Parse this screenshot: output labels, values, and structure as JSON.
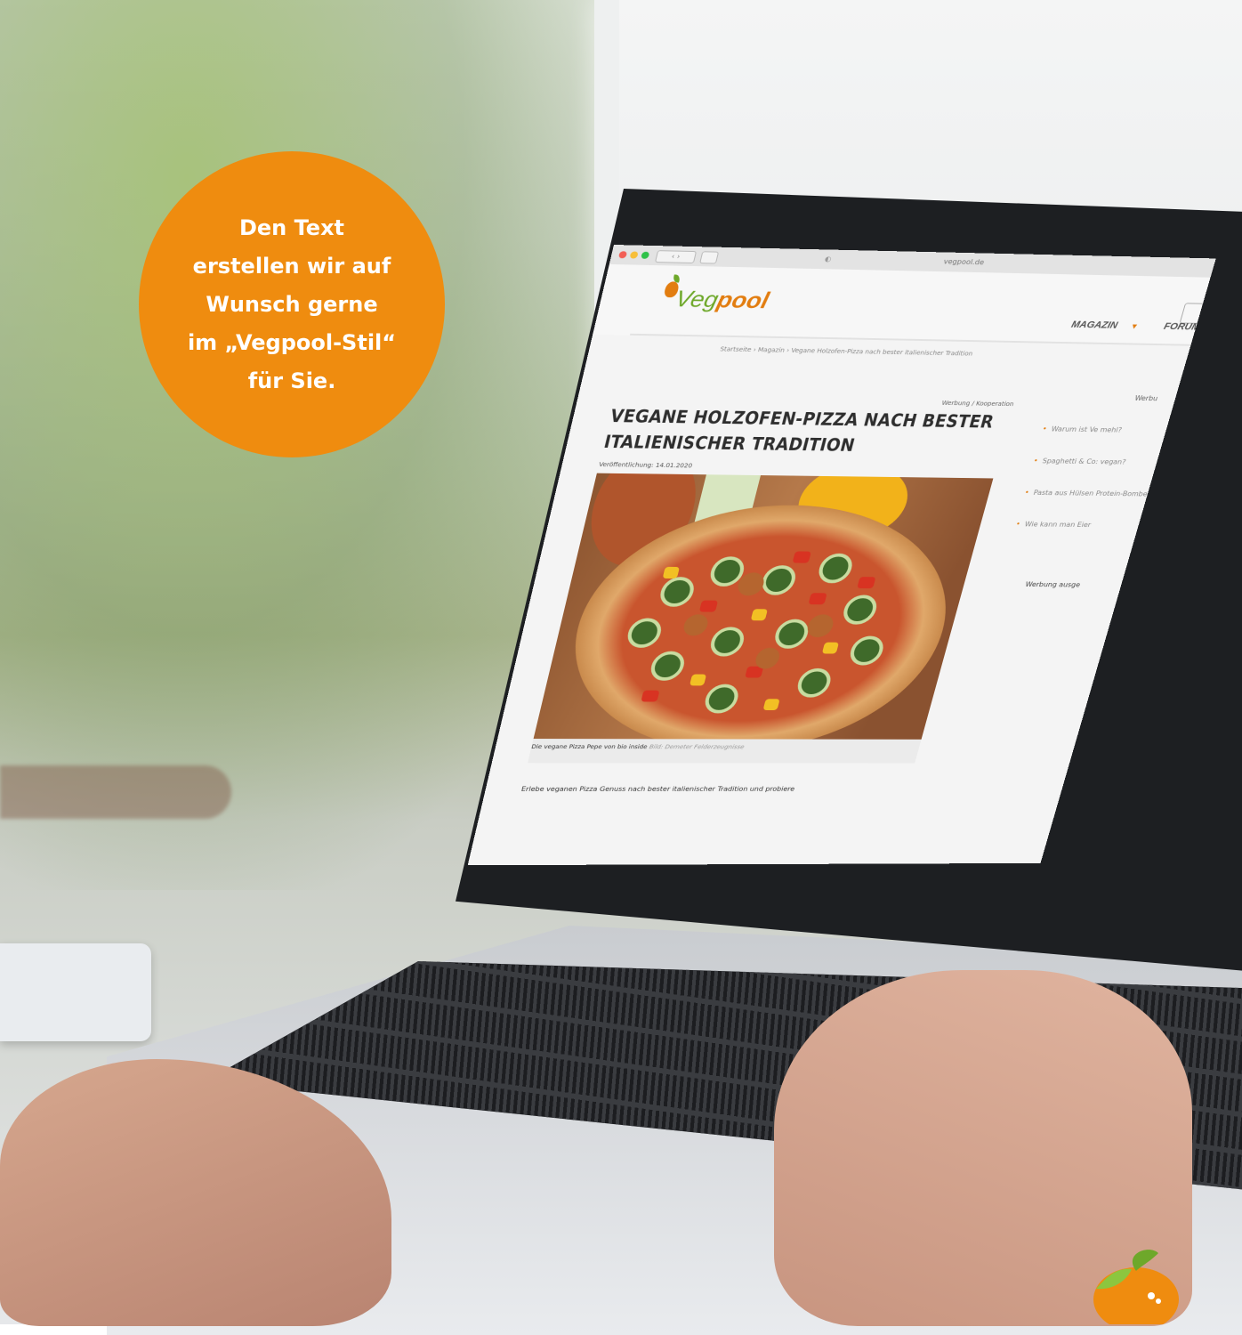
{
  "badge": {
    "text": "Den Text\nerstellen wir auf\nWunsch gerne\nim „Vegpool-Stil“\nfür Sie.",
    "color": "#ef8c0f"
  },
  "browser": {
    "url": "vegpool.de",
    "privacy_icon": "privacy-report-icon",
    "nav_glyphs": "‹ ›"
  },
  "site": {
    "logo_veg": "Veg",
    "logo_pool": "pool",
    "menu": {
      "magazin": "MAGAZIN",
      "forum": "FORUM"
    },
    "breadcrumb": "Startseite › Magazin › Vegane Holzofen-Pizza nach bester italienischer Tradition",
    "ad_label": "Werbung / Kooperation",
    "article_title": "VEGANE HOLZOFEN-PIZZA NACH BESTER ITALIENISCHER TRADITION",
    "published": "Veröffentlichung: 14.01.2020",
    "caption": "Die vegane Pizza Pepe von bio inside",
    "caption_credit": "Bild: Demeter Felderzeugnisse",
    "intro": "Erlebe veganen Pizza Genuss nach bester italienischer Tradition und probiere",
    "sidebar": {
      "head": "Werbu",
      "items": [
        "Warum ist Ve mehl?",
        "Spaghetti & Co: vegan?",
        "Pasta aus Hülsen Protein-Bomben",
        "Wie kann man Eier"
      ],
      "foot": "Werbung ausge"
    }
  },
  "colors": {
    "accent_orange": "#e27d10",
    "accent_green": "#6ea82a"
  }
}
